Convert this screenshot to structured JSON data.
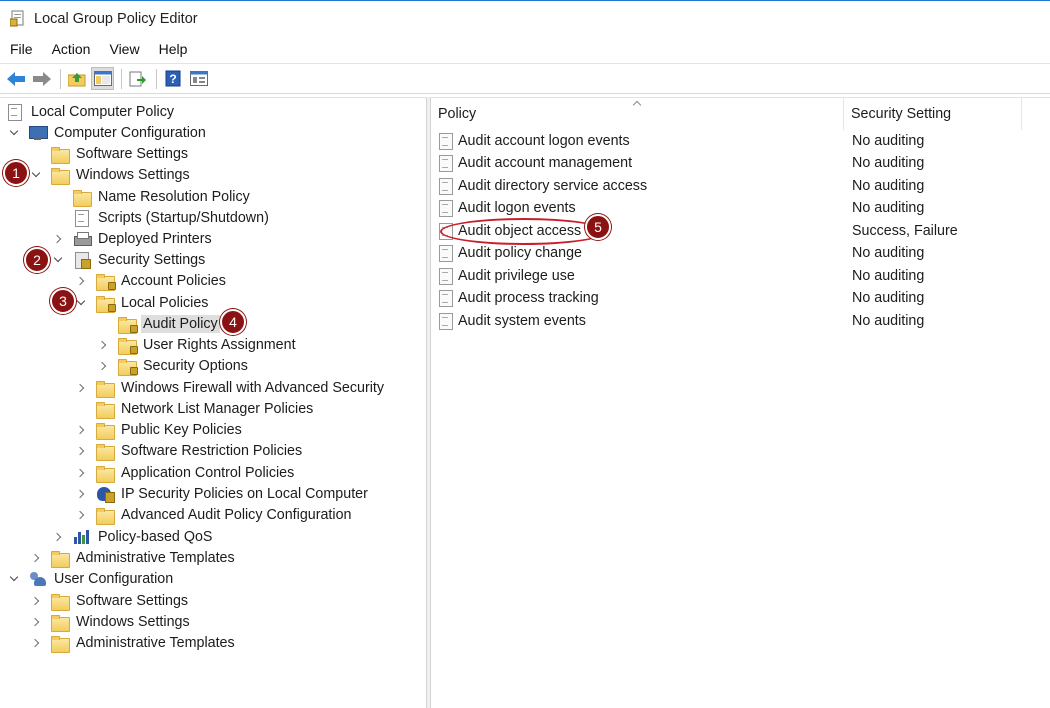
{
  "window": {
    "title": "Local Group Policy Editor"
  },
  "menu": [
    "File",
    "Action",
    "View",
    "Help"
  ],
  "toolbar": {
    "buttons": [
      "back-arrow-icon",
      "forward-arrow-icon",
      "up-folder-icon",
      "show-hide-tree-icon",
      "export-list-icon",
      "help-icon",
      "properties-view-icon"
    ]
  },
  "tree": {
    "root": "Local Computer Policy",
    "computer_configuration": "Computer Configuration",
    "software_settings": "Software Settings",
    "windows_settings": "Windows Settings",
    "name_resolution_policy": "Name Resolution Policy",
    "scripts": "Scripts (Startup/Shutdown)",
    "deployed_printers": "Deployed Printers",
    "security_settings": "Security Settings",
    "account_policies": "Account Policies",
    "local_policies": "Local Policies",
    "audit_policy": "Audit Policy",
    "user_rights_assignment": "User Rights Assignment",
    "security_options": "Security Options",
    "windows_firewall": "Windows Firewall with Advanced Security",
    "network_list_manager": "Network List Manager Policies",
    "public_key_policies": "Public Key Policies",
    "software_restriction": "Software Restriction Policies",
    "application_control": "Application Control Policies",
    "ip_security": "IP Security Policies on Local Computer",
    "advanced_audit": "Advanced Audit Policy Configuration",
    "policy_based_qos": "Policy-based QoS",
    "administrative_templates": "Administrative Templates",
    "user_configuration": "User Configuration",
    "user_software_settings": "Software Settings",
    "user_windows_settings": "Windows Settings",
    "user_administrative_templates": "Administrative Templates"
  },
  "columns": {
    "policy": "Policy",
    "security_setting": "Security Setting"
  },
  "policies": [
    {
      "name": "Audit account logon events",
      "setting": "No auditing"
    },
    {
      "name": "Audit account management",
      "setting": "No auditing"
    },
    {
      "name": "Audit directory service access",
      "setting": "No auditing"
    },
    {
      "name": "Audit logon events",
      "setting": "No auditing"
    },
    {
      "name": "Audit object access",
      "setting": "Success, Failure"
    },
    {
      "name": "Audit policy change",
      "setting": "No auditing"
    },
    {
      "name": "Audit privilege use",
      "setting": "No auditing"
    },
    {
      "name": "Audit process tracking",
      "setting": "No auditing"
    },
    {
      "name": "Audit system events",
      "setting": "No auditing"
    }
  ],
  "annotations": {
    "step1": "1",
    "step2": "2",
    "step3": "3",
    "step4": "4",
    "step5": "5"
  },
  "colors": {
    "badge": "#8b1212",
    "highlight": "#c8202a",
    "title_accent": "#1e78d7"
  }
}
